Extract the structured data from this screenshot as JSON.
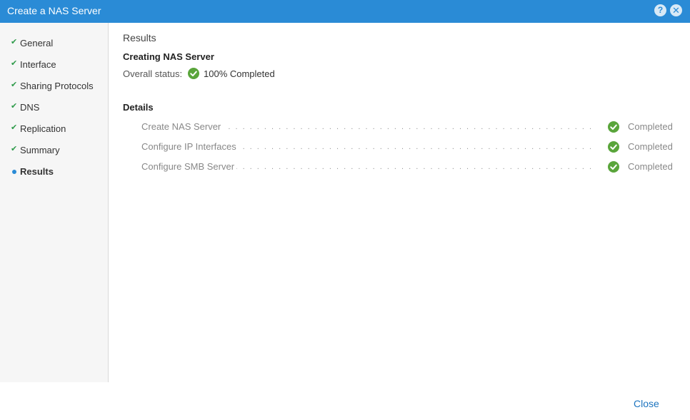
{
  "window": {
    "title": "Create a NAS Server",
    "help_icon": "help-icon",
    "close_icon": "close-icon"
  },
  "sidebar": {
    "steps": [
      {
        "label": "General",
        "state": "done"
      },
      {
        "label": "Interface",
        "state": "done"
      },
      {
        "label": "Sharing Protocols",
        "state": "done"
      },
      {
        "label": "DNS",
        "state": "done"
      },
      {
        "label": "Replication",
        "state": "done"
      },
      {
        "label": "Summary",
        "state": "done"
      },
      {
        "label": "Results",
        "state": "current"
      }
    ]
  },
  "results": {
    "heading": "Results",
    "subheading": "Creating NAS Server",
    "overall_label": "Overall status:",
    "overall_status": "100% Completed",
    "details_heading": "Details",
    "tasks": [
      {
        "name": "Create NAS Server",
        "status": "Completed"
      },
      {
        "name": "Configure IP Interfaces",
        "status": "Completed"
      },
      {
        "name": "Configure SMB Server",
        "status": "Completed"
      }
    ]
  },
  "footer": {
    "close_label": "Close"
  },
  "colors": {
    "titlebar": "#2a8bd6",
    "success": "#5aa53b",
    "link": "#1c74bf"
  }
}
